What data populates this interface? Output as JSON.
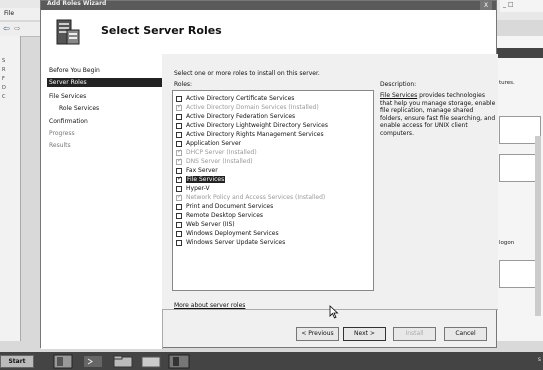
{
  "background": {
    "menu_file": "File",
    "right_pane_text": "tures.",
    "right_pane_text2": "logon",
    "tree_items": [
      "S",
      "R",
      "F",
      "D",
      "C"
    ]
  },
  "dialog": {
    "title": "Add Roles Wizard",
    "close_label": "X",
    "banner_title": "Select Server Roles",
    "nav": [
      {
        "label": "Before You Begin",
        "state": "normal"
      },
      {
        "label": "Server Roles",
        "state": "active"
      },
      {
        "label": "File Services",
        "state": "normal"
      },
      {
        "label": "Role Services",
        "state": "normal",
        "sub": true
      },
      {
        "label": "Confirmation",
        "state": "normal"
      },
      {
        "label": "Progress",
        "state": "dim"
      },
      {
        "label": "Results",
        "state": "dim"
      }
    ],
    "instruction": "Select one or more roles to install on this server.",
    "roles_label": "Roles:",
    "description_label": "Description:",
    "roles": [
      {
        "label": "Active Directory Certificate Services",
        "checked": false,
        "installed": false
      },
      {
        "label": "Active Directory Domain Services (Installed)",
        "checked": true,
        "installed": true
      },
      {
        "label": "Active Directory Federation Services",
        "checked": false,
        "installed": false
      },
      {
        "label": "Active Directory Lightweight Directory Services",
        "checked": false,
        "installed": false
      },
      {
        "label": "Active Directory Rights Management Services",
        "checked": false,
        "installed": false
      },
      {
        "label": "Application Server",
        "checked": false,
        "installed": false
      },
      {
        "label": "DHCP Server (Installed)",
        "checked": true,
        "installed": true
      },
      {
        "label": "DNS Server (Installed)",
        "checked": true,
        "installed": true
      },
      {
        "label": "Fax Server",
        "checked": false,
        "installed": false
      },
      {
        "label": "File Services",
        "checked": true,
        "installed": false,
        "selected": true
      },
      {
        "label": "Hyper-V",
        "checked": false,
        "installed": false
      },
      {
        "label": "Network Policy and Access Services (Installed)",
        "checked": true,
        "installed": true
      },
      {
        "label": "Print and Document Services",
        "checked": false,
        "installed": false
      },
      {
        "label": "Remote Desktop Services",
        "checked": false,
        "installed": false
      },
      {
        "label": "Web Server (IIS)",
        "checked": false,
        "installed": false
      },
      {
        "label": "Windows Deployment Services",
        "checked": false,
        "installed": false
      },
      {
        "label": "Windows Server Update Services",
        "checked": false,
        "installed": false
      }
    ],
    "description_link": "File Services",
    "description_text": " provides technologies that help you manage storage, enable file replication, manage shared folders, ensure fast file searching, and enable access for UNIX client computers.",
    "more_link": "More about server roles",
    "buttons": {
      "previous": "< Previous",
      "next": "Next >",
      "install": "Install",
      "cancel": "Cancel"
    }
  },
  "taskbar": {
    "start_label": "Start",
    "tray_text": "s"
  }
}
